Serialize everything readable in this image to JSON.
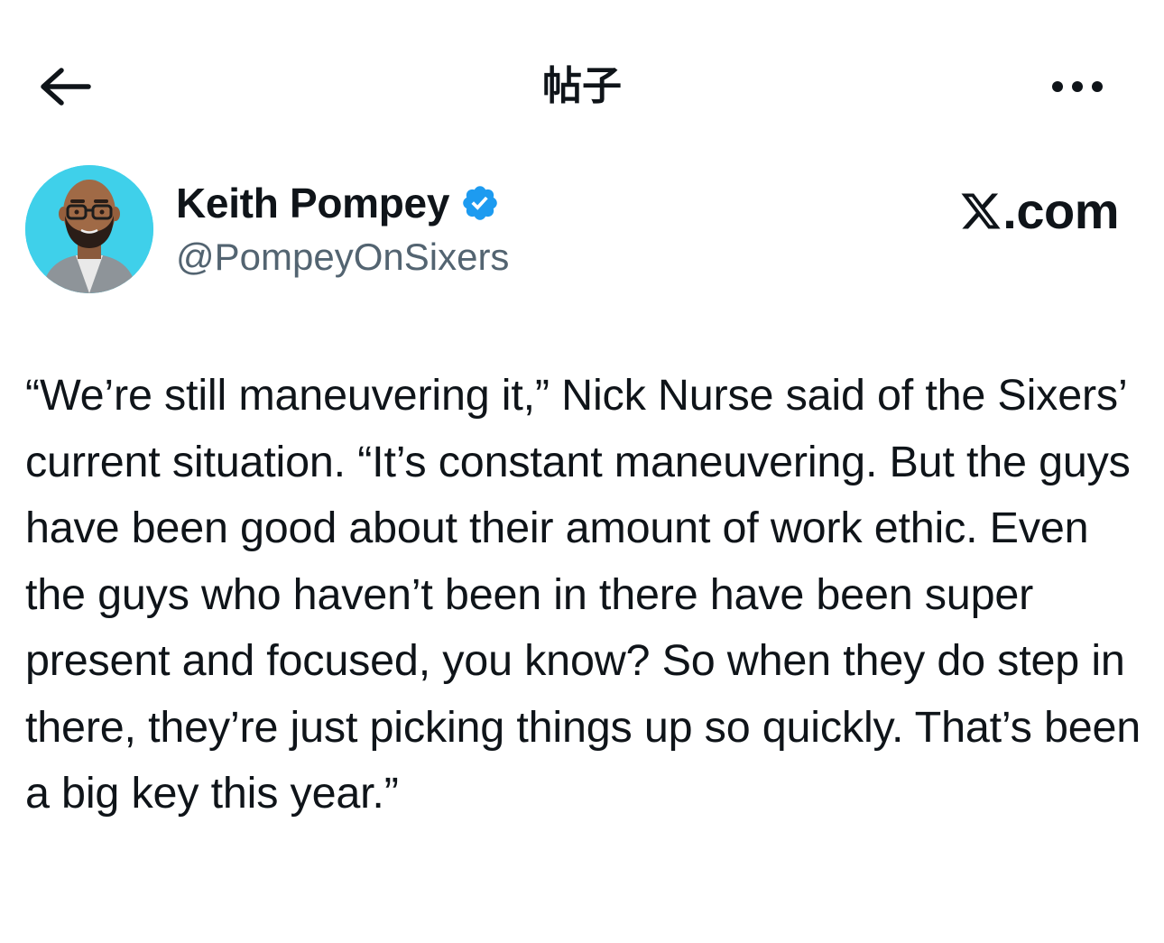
{
  "header": {
    "title": "帖子",
    "back_icon": "arrow-left-icon",
    "more_icon": "more-horizontal-icon"
  },
  "author": {
    "display_name": "Keith Pompey",
    "handle": "@PompeyOnSixers",
    "verified": true,
    "verified_color": "#1d9bf0",
    "avatar_background": "#3fd0ea"
  },
  "brand": {
    "text": ".com",
    "logo_icon": "x-logo-icon"
  },
  "tweet": {
    "text": "“We’re still maneuvering it,” Nick Nurse said of the Sixers’ current situation. “It’s constant maneuvering. But the guys have been good about their amount of work ethic. Even the guys who haven’t been in there have been super present and focused, you know? So when they do step in there, they’re just picking things up so quickly. That’s been a big key this year.”"
  },
  "colors": {
    "text_primary": "#0f1419",
    "text_secondary": "#536471",
    "background": "#ffffff"
  }
}
